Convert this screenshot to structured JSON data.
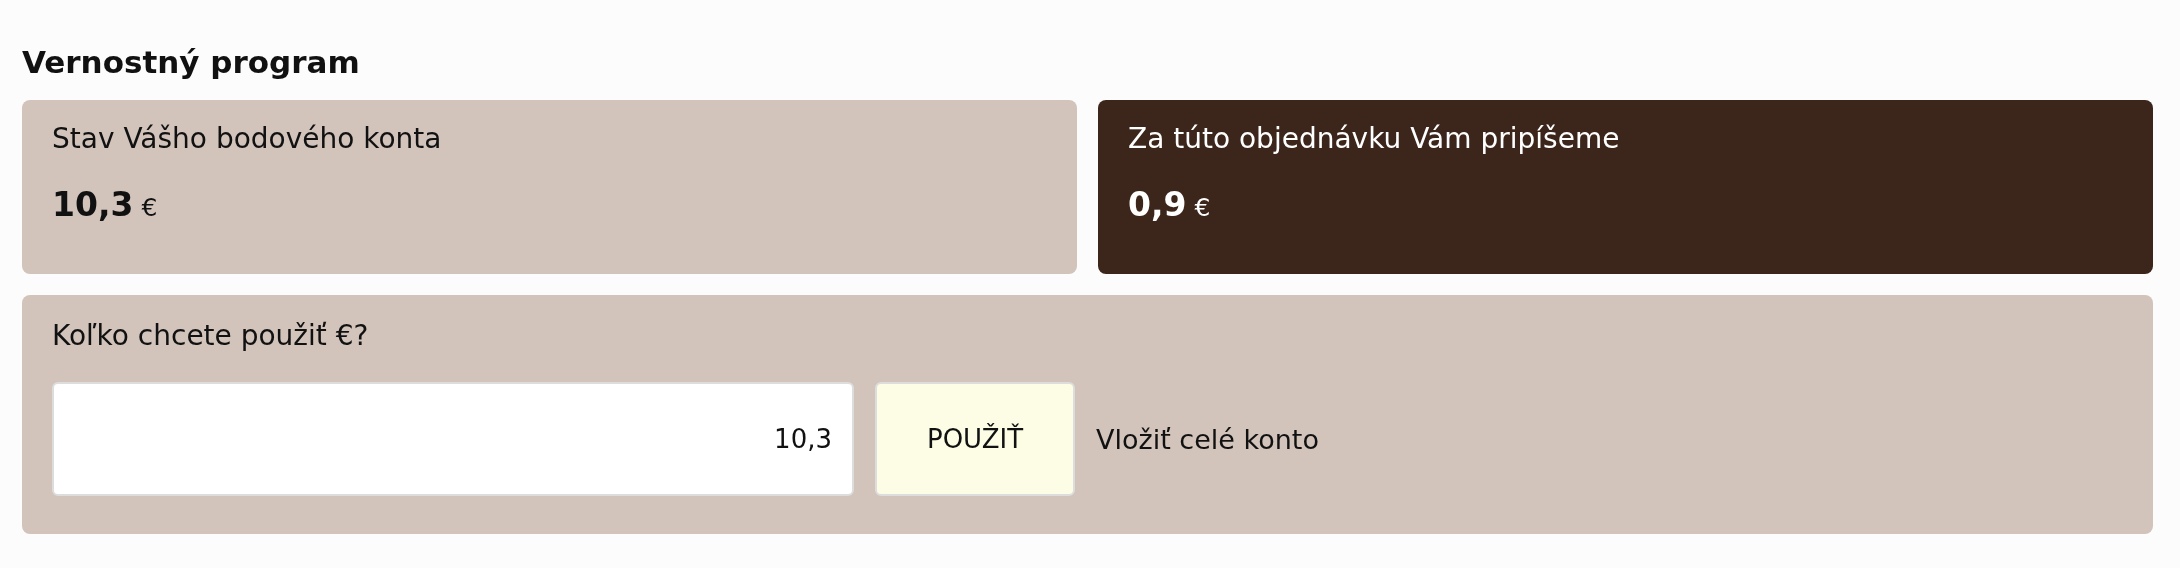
{
  "heading": "Vernostný program",
  "cards": [
    {
      "kind": "light",
      "label": "Stav Vášho bodového konta",
      "amount": "10,3",
      "currency": "€"
    },
    {
      "kind": "dark",
      "label": "Za túto objednávku Vám pripíšeme",
      "amount": "0,9",
      "currency": "€"
    }
  ],
  "redeem": {
    "question": "Koľko chcete použiť €?",
    "input_value": "10,3",
    "button": "POUŽIŤ",
    "link": "Vložiť celé konto"
  }
}
